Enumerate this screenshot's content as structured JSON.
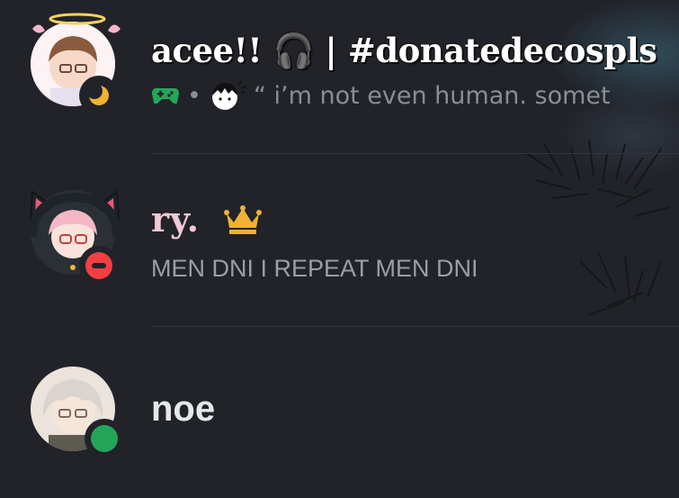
{
  "members": [
    {
      "name": "acee!! 🎧 | #donatedecospls",
      "activity_separator": "•",
      "status_text": "“ i’m not even human. somet",
      "status": "idle",
      "status_color": "#f0b232"
    },
    {
      "name": "ry.",
      "status_text": "MEN DNI I REPEAT MEN DNI",
      "status": "dnd",
      "status_color": "#f23f43",
      "crown_color": "#f0b232"
    },
    {
      "name": "noe",
      "status": "online",
      "status_color": "#23a55a"
    }
  ],
  "icons": {
    "game": "gamepad-icon",
    "crown": "crown-icon",
    "idle": "moon-icon",
    "dnd": "minus-icon"
  },
  "colors": {
    "background": "#222329",
    "name_ry": "#f2c9d6",
    "game_icon": "#23a55a"
  }
}
